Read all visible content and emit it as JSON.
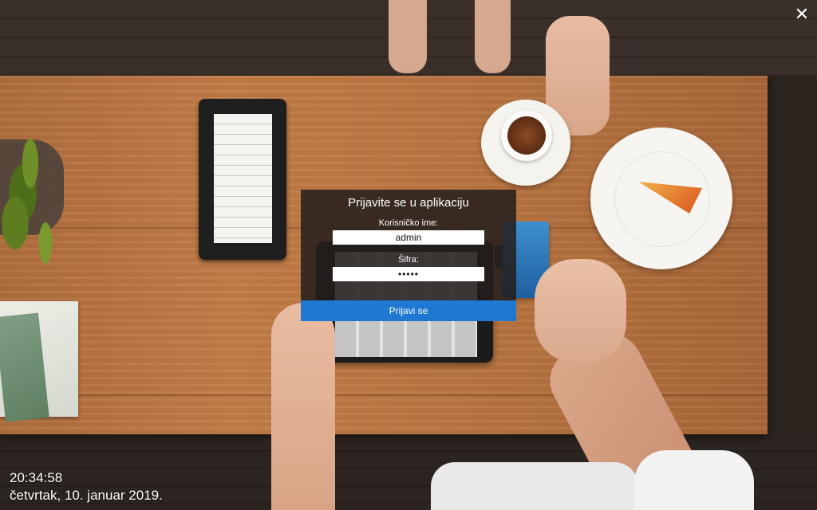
{
  "login": {
    "title": "Prijavite se u aplikaciju",
    "username_label": "Korisničko ime:",
    "username_value": "admin",
    "password_label": "Šifra:",
    "password_value": "•••••",
    "submit_label": "Prijavi se"
  },
  "window": {
    "close_icon": "close-icon",
    "close_glyph": "✕"
  },
  "status": {
    "time": "20:34:58",
    "date": "četvrtak, 10. januar 2019."
  },
  "colors": {
    "accent": "#1f78d1",
    "panel_bg": "#241e1c"
  }
}
